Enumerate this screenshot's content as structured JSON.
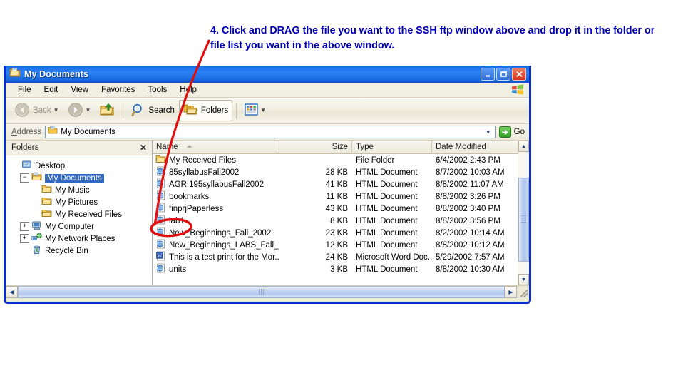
{
  "annotation": {
    "text": "4. Click and DRAG the file you want to the SSH ftp window above and drop it in the folder or file list you want in the above window.",
    "color": "#0000b0",
    "marker_color": "#e01010",
    "circled_item": "lab1"
  },
  "window": {
    "title": "My Documents",
    "icon": "my-documents-folder-icon",
    "controls": {
      "minimize": "_",
      "maximize": "□",
      "close": "✕"
    }
  },
  "menu": {
    "items": [
      {
        "label": "File",
        "accel": "F"
      },
      {
        "label": "Edit",
        "accel": "E"
      },
      {
        "label": "View",
        "accel": "V"
      },
      {
        "label": "Favorites",
        "accel": "a"
      },
      {
        "label": "Tools",
        "accel": "T"
      },
      {
        "label": "Help",
        "accel": "H"
      }
    ],
    "logo": "windows-flag-logo"
  },
  "toolbar": {
    "back_label": "Back",
    "forward_label": "",
    "up_label": "",
    "search_label": "Search",
    "folders_label": "Folders",
    "views_label": "",
    "back_disabled": true,
    "folders_pressed": true
  },
  "address": {
    "label": "Address",
    "value": "My Documents",
    "icon": "my-documents-folder-icon",
    "go_label": "Go"
  },
  "folders_pane": {
    "header": "Folders",
    "close_label": "✕",
    "tree": [
      {
        "label": "Desktop",
        "indent": 0,
        "expander": "",
        "icon": "desktop-icon",
        "selected": false
      },
      {
        "label": "My Documents",
        "indent": 1,
        "expander": "−",
        "icon": "my-documents-icon",
        "selected": true
      },
      {
        "label": "My Music",
        "indent": 2,
        "expander": "",
        "icon": "folder-icon",
        "selected": false
      },
      {
        "label": "My Pictures",
        "indent": 2,
        "expander": "",
        "icon": "folder-icon",
        "selected": false
      },
      {
        "label": "My Received Files",
        "indent": 2,
        "expander": "",
        "icon": "folder-icon",
        "selected": false
      },
      {
        "label": "My Computer",
        "indent": 1,
        "expander": "+",
        "icon": "my-computer-icon",
        "selected": false
      },
      {
        "label": "My Network Places",
        "indent": 1,
        "expander": "+",
        "icon": "network-places-icon",
        "selected": false
      },
      {
        "label": "Recycle Bin",
        "indent": 1,
        "expander": "",
        "icon": "recycle-bin-icon",
        "selected": false
      }
    ]
  },
  "file_list": {
    "columns": [
      "Name",
      "Size",
      "Type",
      "Date Modified"
    ],
    "sort_column": "Name",
    "sort_direction": "ascending",
    "rows": [
      {
        "name": "My Received Files",
        "size": "",
        "type": "File Folder",
        "date": "6/4/2002 2:43 PM",
        "icon": "folder-icon"
      },
      {
        "name": "85syllabusFall2002",
        "size": "28 KB",
        "type": "HTML Document",
        "date": "8/7/2002 10:03 AM",
        "icon": "html-document-icon"
      },
      {
        "name": "AGRI195syllabusFall2002",
        "size": "41 KB",
        "type": "HTML Document",
        "date": "8/8/2002 11:07 AM",
        "icon": "html-document-icon"
      },
      {
        "name": "bookmarks",
        "size": "11 KB",
        "type": "HTML Document",
        "date": "8/8/2002 3:26 PM",
        "icon": "html-document-icon"
      },
      {
        "name": "finprjPaperless",
        "size": "43 KB",
        "type": "HTML Document",
        "date": "8/8/2002 3:40 PM",
        "icon": "html-document-icon"
      },
      {
        "name": "lab1",
        "size": "8 KB",
        "type": "HTML Document",
        "date": "8/8/2002 3:56 PM",
        "icon": "html-document-icon"
      },
      {
        "name": "New_Beginnings_Fall_2002",
        "size": "23 KB",
        "type": "HTML Document",
        "date": "8/2/2002 10:14 AM",
        "icon": "html-document-icon"
      },
      {
        "name": "New_Beginnings_LABS_Fall_2...",
        "size": "12 KB",
        "type": "HTML Document",
        "date": "8/8/2002 10:12 AM",
        "icon": "html-document-icon"
      },
      {
        "name": "This is a test print for the Mor...",
        "size": "24 KB",
        "type": "Microsoft Word Doc...",
        "date": "5/29/2002 7:57 AM",
        "icon": "word-document-icon"
      },
      {
        "name": "units",
        "size": "3 KB",
        "type": "HTML Document",
        "date": "8/8/2002 10:30 AM",
        "icon": "html-document-icon"
      }
    ]
  }
}
